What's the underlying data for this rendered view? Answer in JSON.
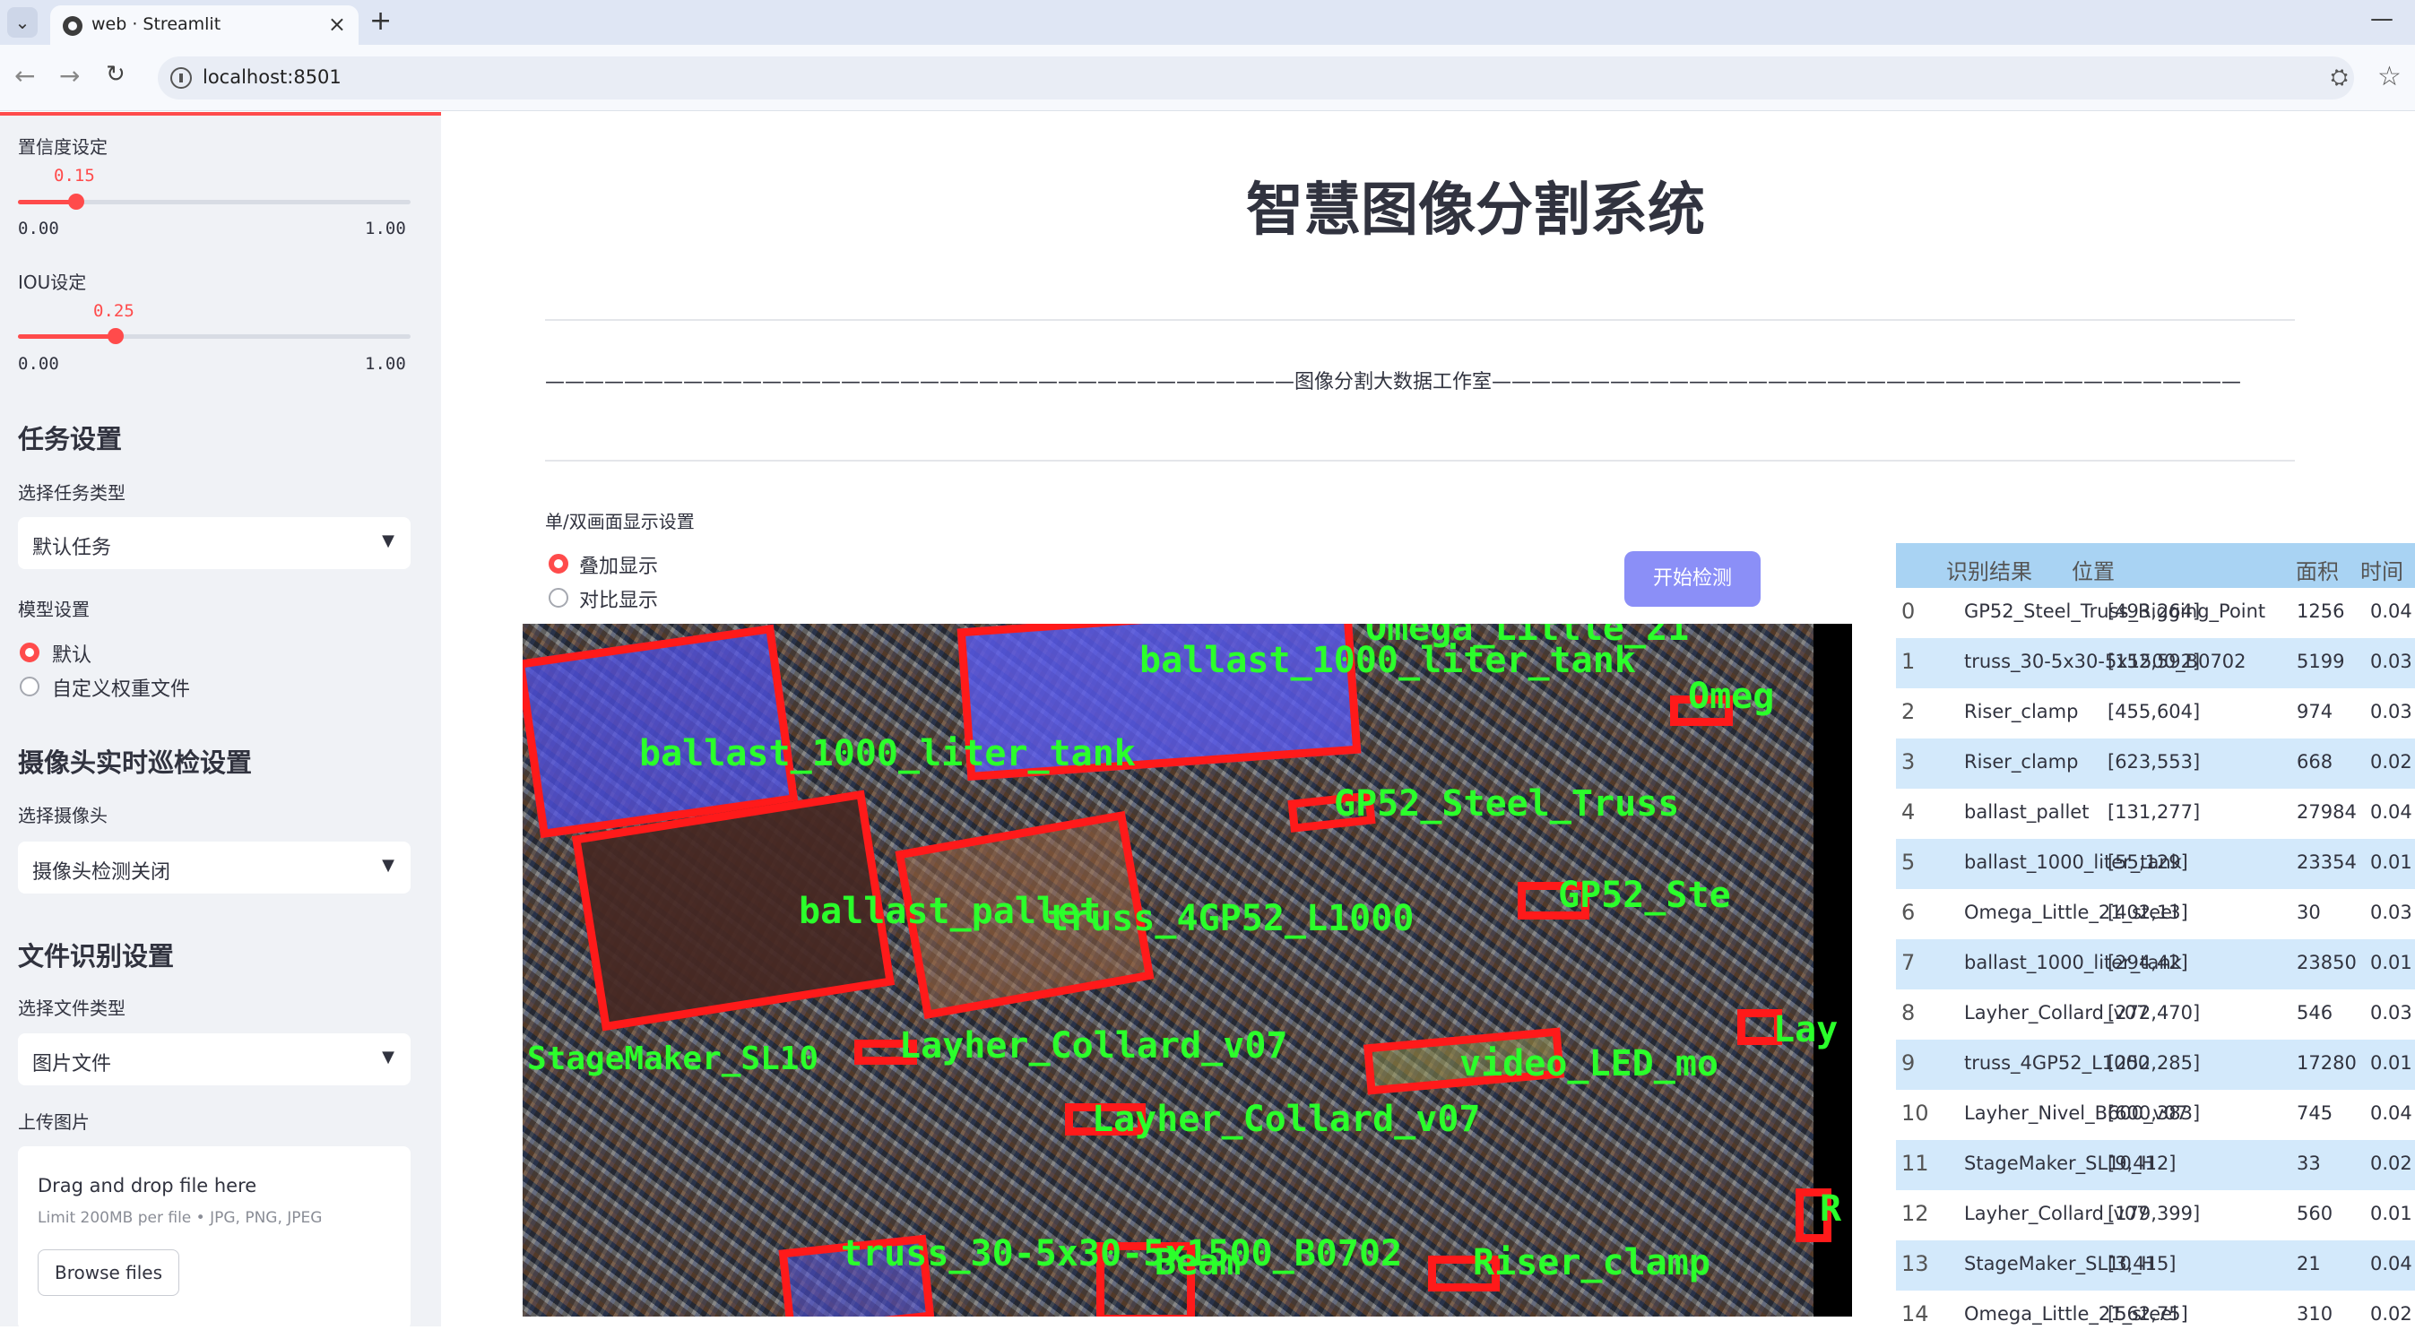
{
  "browser": {
    "tab_title": "web · Streamlit",
    "url": "localhost:8501"
  },
  "sidebar": {
    "confidence": {
      "label": "置信度设定",
      "value": "0.15",
      "value_fraction": 0.15,
      "min": "0.00",
      "max": "1.00"
    },
    "iou": {
      "label": "IOU设定",
      "value": "0.25",
      "value_fraction": 0.25,
      "min": "0.00",
      "max": "1.00"
    },
    "task_section": "任务设置",
    "task_type_label": "选择任务类型",
    "task_type_value": "默认任务",
    "model_label": "模型设置",
    "model_options": [
      "默认",
      "自定义权重文件"
    ],
    "camera_section": "摄像头实时巡检设置",
    "camera_label": "选择摄像头",
    "camera_value": "摄像头检测关闭",
    "file_section": "文件识别设置",
    "file_type_label": "选择文件类型",
    "file_type_value": "图片文件",
    "upload_label": "上传图片",
    "upload_main": "Drag and drop file here",
    "upload_sub": "Limit 200MB per file • JPG, PNG, JPEG",
    "browse_label": "Browse files"
  },
  "main": {
    "title": "智慧图像分割系统",
    "studio": "——————————————————————————————————————图像分割大数据工作室——————————————————————————————————————",
    "display_label": "单/双画面显示设置",
    "display_options": [
      "叠加显示",
      "对比显示"
    ],
    "detect_button": "开始检测"
  },
  "image_labels": [
    "Omega_Little_21",
    "ballast_1000_liter_tank",
    "Omeg",
    "ballast_1000_liter_tank",
    "GP52_Steel_Truss",
    "GP52_Ste",
    "ballast_pallet",
    "truss_4GP52_L1000",
    "Lay",
    "StageMaker_SL10",
    "Layher_Collard_v07",
    "video_LED_mo",
    "Layher_Collard_v07",
    "R",
    "truss_30-5x30-5x1500_B0702",
    "Beam",
    "Riser_clamp"
  ],
  "results": {
    "headers": [
      "识别结果",
      "位置",
      "面积",
      "时间"
    ],
    "rows": [
      {
        "idx": "0",
        "name": "GP52_Steel_Truss_Rigging_Point",
        "pos": "[493,264]",
        "area": "1256",
        "time": "0.04"
      },
      {
        "idx": "1",
        "name": "truss_30-5x30-5x1500_B0702",
        "pos": "[152,592]",
        "area": "5199",
        "time": "0.03"
      },
      {
        "idx": "2",
        "name": "Riser_clamp",
        "pos": "[455,604]",
        "area": "974",
        "time": "0.03"
      },
      {
        "idx": "3",
        "name": "Riser_clamp",
        "pos": "[623,553]",
        "area": "668",
        "time": "0.02"
      },
      {
        "idx": "4",
        "name": "ballast_pallet",
        "pos": "[131,277]",
        "area": "27984",
        "time": "0.04"
      },
      {
        "idx": "5",
        "name": "ballast_1000_liter_tank",
        "pos": "[55,129]",
        "area": "23354",
        "time": "0.01"
      },
      {
        "idx": "6",
        "name": "Omega_Little_21_steel",
        "pos": "[402,13]",
        "area": "30",
        "time": "0.03"
      },
      {
        "idx": "7",
        "name": "ballast_1000_liter_tank",
        "pos": "[294,42]",
        "area": "23850",
        "time": "0.01"
      },
      {
        "idx": "8",
        "name": "Layher_Collard_v07",
        "pos": "[272,470]",
        "area": "546",
        "time": "0.03"
      },
      {
        "idx": "9",
        "name": "truss_4GP52_L1000",
        "pos": "[252,285]",
        "area": "17280",
        "time": "0.01"
      },
      {
        "idx": "10",
        "name": "Layher_Nivel_B600_v07",
        "pos": "[600,383]",
        "area": "745",
        "time": "0.04"
      },
      {
        "idx": "11",
        "name": "StageMaker_SL10_H",
        "pos": "[9,412]",
        "area": "33",
        "time": "0.02"
      },
      {
        "idx": "12",
        "name": "Layher_Collard_v07",
        "pos": "[179,399]",
        "area": "560",
        "time": "0.01"
      },
      {
        "idx": "13",
        "name": "StageMaker_SL10_H",
        "pos": "[3,415]",
        "area": "21",
        "time": "0.04"
      },
      {
        "idx": "14",
        "name": "Omega_Little_21_steel",
        "pos": "[562,75]",
        "area": "310",
        "time": "0.02"
      }
    ]
  }
}
